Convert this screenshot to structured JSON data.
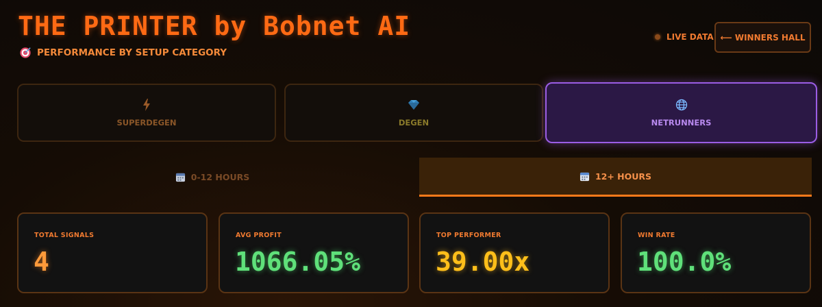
{
  "header": {
    "title": "THE PRINTER by Bobnet AI",
    "subtitle": "PERFORMANCE BY SETUP CATEGORY",
    "live_label": "LIVE DATA",
    "winners_button": "⟵ WINNERS HALL"
  },
  "categories": [
    {
      "label": "SUPERDEGEN",
      "icon": "lightning-icon",
      "active": false
    },
    {
      "label": "DEGEN",
      "icon": "diamond-icon",
      "active": false
    },
    {
      "label": "NETRUNNERS",
      "icon": "globe-icon",
      "active": true
    }
  ],
  "time_tabs": [
    {
      "label": "0-12 HOURS",
      "active": false
    },
    {
      "label": "12+ HOURS",
      "active": true
    }
  ],
  "stats": [
    {
      "label": "TOTAL SIGNALS",
      "value": "4"
    },
    {
      "label": "AVG PROFIT",
      "value": "1066.05%"
    },
    {
      "label": "TOP PERFORMER",
      "value": "39.00x"
    },
    {
      "label": "WIN RATE",
      "value": "100.0%"
    }
  ],
  "colors": {
    "accent": "#ff6a14",
    "active_category": "#9b5de5",
    "green": "#5fe07a",
    "gold": "#ffbf1a"
  }
}
